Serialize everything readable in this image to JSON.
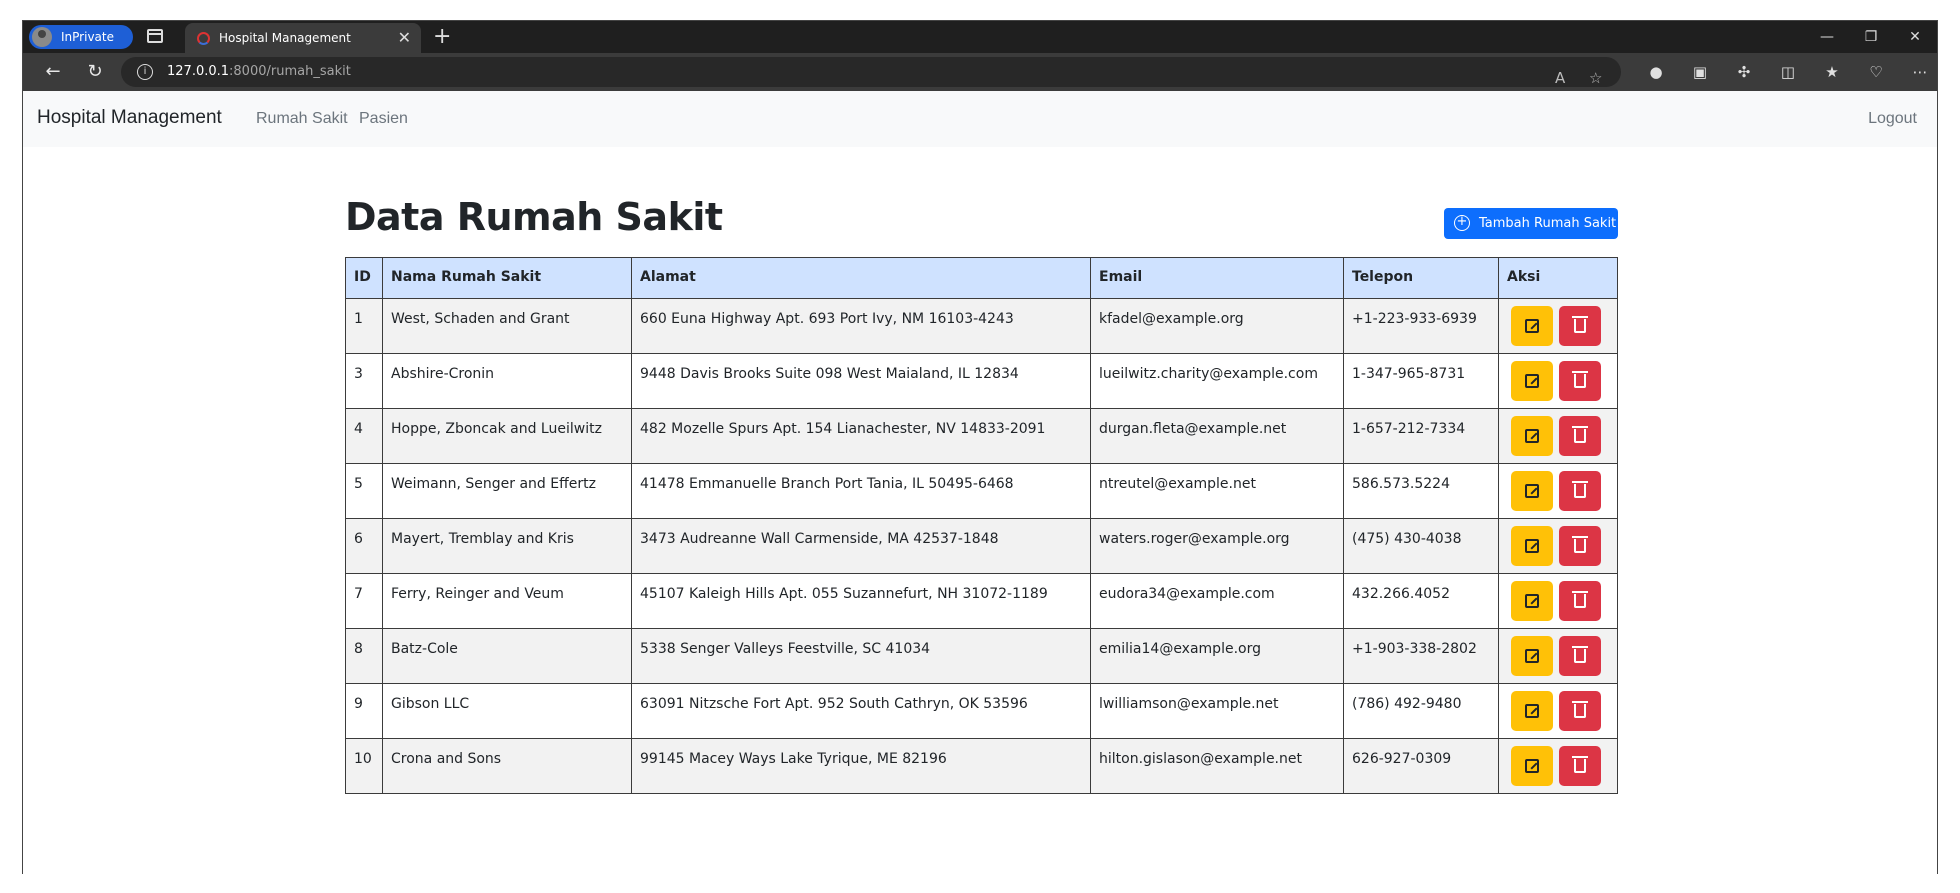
{
  "browser": {
    "inprivate_label": "InPrivate (2)",
    "tab_title": "Hospital Management",
    "new_tab_symbol": "+",
    "url_host": "127.0.0.1",
    "url_path": ":8000/rumah_sakit"
  },
  "navbar": {
    "brand": "Hospital Management",
    "links": [
      "Rumah Sakit",
      "Pasien"
    ],
    "logout": "Logout"
  },
  "page": {
    "title": "Data Rumah Sakit",
    "add_button": "Tambah Rumah Sakit"
  },
  "table": {
    "headers": [
      "ID",
      "Nama Rumah Sakit",
      "Alamat",
      "Email",
      "Telepon",
      "Aksi"
    ],
    "rows": [
      [
        "1",
        "West, Schaden and Grant",
        "660 Euna Highway Apt. 693 Port Ivy, NM 16103-4243",
        "kfadel@example.org",
        "+1-223-933-6939"
      ],
      [
        "3",
        "Abshire-Cronin",
        "9448 Davis Brooks Suite 098 West Maialand, IL 12834",
        "lueilwitz.charity@example.com",
        "1-347-965-8731"
      ],
      [
        "4",
        "Hoppe, Zboncak and Lueilwitz",
        "482 Mozelle Spurs Apt. 154 Lianachester, NV 14833-2091",
        "durgan.fleta@example.net",
        "1-657-212-7334"
      ],
      [
        "5",
        "Weimann, Senger and Effertz",
        "41478 Emmanuelle Branch Port Tania, IL 50495-6468",
        "ntreutel@example.net",
        "586.573.5224"
      ],
      [
        "6",
        "Mayert, Tremblay and Kris",
        "3473 Audreanne Wall Carmenside, MA 42537-1848",
        "waters.roger@example.org",
        "(475) 430-4038"
      ],
      [
        "7",
        "Ferry, Reinger and Veum",
        "45107 Kaleigh Hills Apt. 055 Suzannefurt, NH 31072-1189",
        "eudora34@example.com",
        "432.266.4052"
      ],
      [
        "8",
        "Batz-Cole",
        "5338 Senger Valleys Feestville, SC 41034",
        "emilia14@example.org",
        "+1-903-338-2802"
      ],
      [
        "9",
        "Gibson LLC",
        "63091 Nitzsche Fort Apt. 952 South Cathryn, OK 53596",
        "lwilliamson@example.net",
        "(786) 492-9480"
      ],
      [
        "10",
        "Crona and Sons",
        "99145 Macey Ways Lake Tyrique, ME 82196",
        "hilton.gislason@example.net",
        "626-927-0309"
      ]
    ]
  },
  "colors": {
    "primary": "#0d6efd",
    "warning": "#ffc107",
    "danger": "#dc3545",
    "header_bg": "#cfe2ff",
    "navbar_bg": "#f8f9fa"
  },
  "icons": {
    "add": "plus-circle-icon",
    "edit": "edit-icon",
    "delete": "trash-icon"
  }
}
